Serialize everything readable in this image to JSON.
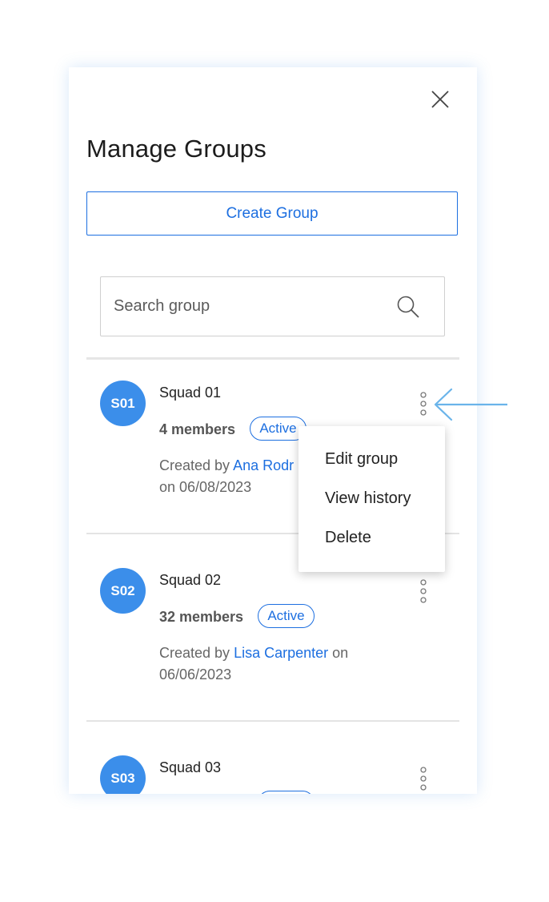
{
  "dialog": {
    "title": "Manage Groups",
    "create_label": "Create Group",
    "search_placeholder": "Search group"
  },
  "groups": [
    {
      "initials": "S01",
      "name": "Squad 01",
      "members": "4 members",
      "status": "Active",
      "created_prefix": "Created by ",
      "creator": "Ana Rodr",
      "created_suffix": "",
      "created_date": "on 06/08/2023"
    },
    {
      "initials": "S02",
      "name": "Squad 02",
      "members": "32 members",
      "status": "Active",
      "created_prefix": "Created by ",
      "creator": "Lisa Carpenter",
      "created_suffix": " on",
      "created_date": "06/06/2023"
    },
    {
      "initials": "S03",
      "name": "Squad 03"
    }
  ],
  "context_menu": {
    "items": [
      "Edit group",
      "View history",
      "Delete"
    ]
  },
  "colors": {
    "accent": "#1d6fe0",
    "avatar": "#3b8eea",
    "arrow": "#6ab4ea"
  },
  "icons": {
    "close": "close-icon",
    "search": "search-icon",
    "more": "kebab-menu-icon",
    "annotation": "arrow-left-icon"
  }
}
